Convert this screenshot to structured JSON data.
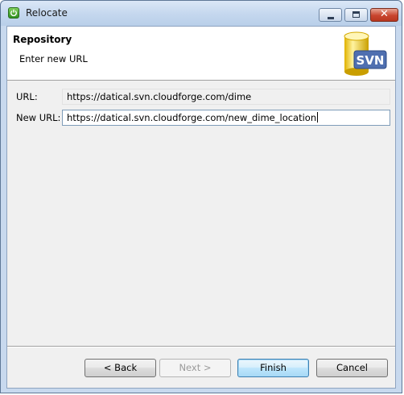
{
  "window": {
    "title": "Relocate",
    "icon": "power-icon",
    "controls": {
      "minimize": "minimize-icon",
      "maximize": "maximize-icon",
      "close": "close-icon"
    }
  },
  "banner": {
    "title": "Repository",
    "description": "Enter new URL",
    "logo_text": "SVN"
  },
  "form": {
    "url_label": "URL:",
    "url_value": "https://datical.svn.cloudforge.com/dime",
    "new_url_label": "New URL:",
    "new_url_value": "https://datical.svn.cloudforge.com/new_dime_location"
  },
  "buttons": {
    "back": "< Back",
    "next": "Next >",
    "finish": "Finish",
    "cancel": "Cancel"
  },
  "colors": {
    "titlebar": "#c4d7ee",
    "close_button": "#c9452e",
    "default_button": "#bee6fd"
  }
}
